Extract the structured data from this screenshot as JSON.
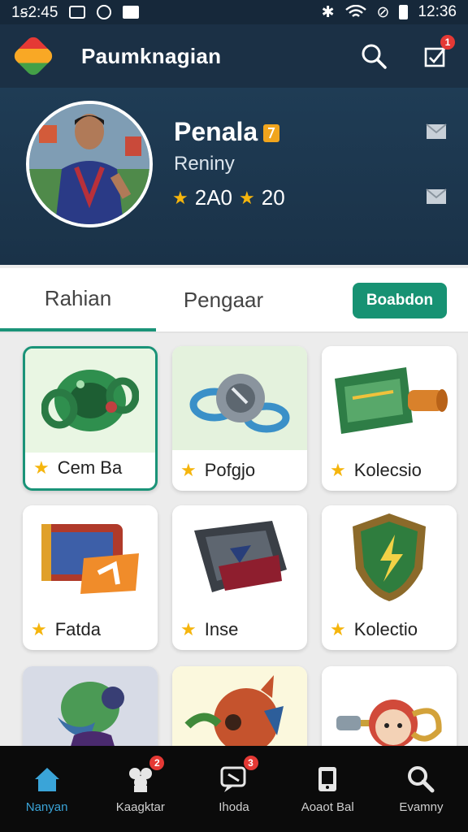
{
  "status_bar": {
    "time": "1ꞩ2:45",
    "clock": "12:36"
  },
  "app_bar": {
    "title": "Paumknagian",
    "notification_count": "1",
    "icons": [
      "search-icon",
      "edit-checklist-icon"
    ]
  },
  "profile": {
    "name": "Penala",
    "subtitle": "Reniny",
    "stats": "2A0",
    "stats2": "20"
  },
  "tabs": {
    "tab1": "Rahian",
    "tab2": "Pengaar",
    "action": "Boabdon"
  },
  "cards": [
    {
      "label": "Cem Ba",
      "icon": "green-ring-icon",
      "bg": "#e9f6e3"
    },
    {
      "label": "Pofgjo",
      "icon": "blue-chain-icon",
      "bg": "#e4f2dd"
    },
    {
      "label": "Kolecsio",
      "icon": "banner-scroll-icon",
      "bg": "#ffffff"
    },
    {
      "label": "Fatda",
      "icon": "flag-box-icon",
      "bg": "#ffffff"
    },
    {
      "label": "Inse",
      "icon": "book-badge-icon",
      "bg": "#ffffff"
    },
    {
      "label": "Kolectio",
      "icon": "green-shield-icon",
      "bg": "#ffffff"
    },
    {
      "label": "",
      "icon": "green-creature-icon",
      "bg": "#d7dbe6"
    },
    {
      "label": "",
      "icon": "red-mask-icon",
      "bg": "#fbf8dd"
    },
    {
      "label": "",
      "icon": "face-key-icon",
      "bg": "#ffffff"
    }
  ],
  "bottom_nav": [
    {
      "label": "Nanyan",
      "icon": "home-icon",
      "badge": ""
    },
    {
      "label": "Kaagktar",
      "icon": "cluster-icon",
      "badge": "2"
    },
    {
      "label": "Ihoda",
      "icon": "chat-icon",
      "badge": "3"
    },
    {
      "label": "Aoaot Bal",
      "icon": "device-icon",
      "badge": ""
    },
    {
      "label": "Evamny",
      "icon": "magnifier-icon",
      "badge": ""
    }
  ],
  "colors": {
    "accent": "#1a9378",
    "header": "#1b3045",
    "active_nav": "#3aa4d8"
  }
}
